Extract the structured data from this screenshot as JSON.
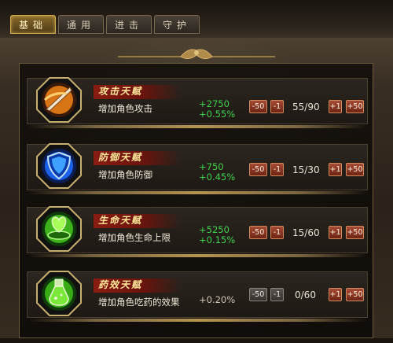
{
  "tabs": [
    {
      "label": "基础",
      "active": true
    },
    {
      "label": "通用",
      "active": false
    },
    {
      "label": "进击",
      "active": false
    },
    {
      "label": "守护",
      "active": false
    }
  ],
  "talents": [
    {
      "name": "攻击天赋",
      "desc": "增加角色攻击",
      "bonus1": "+2750",
      "bonus2": "+0.55%",
      "count": "55/90",
      "minus50": "-50",
      "minus1": "-1",
      "plus1": "+1",
      "plus50": "+50",
      "icon": "sword-slash-icon",
      "minus_enabled": true
    },
    {
      "name": "防御天赋",
      "desc": "增加角色防御",
      "bonus1": "+750",
      "bonus2": "+0.45%",
      "count": "15/30",
      "minus50": "-50",
      "minus1": "-1",
      "plus1": "+1",
      "plus50": "+50",
      "icon": "shield-icon",
      "minus_enabled": true
    },
    {
      "name": "生命天赋",
      "desc": "增加角色生命上限",
      "bonus1": "+5250",
      "bonus2": "+0.15%",
      "count": "15/60",
      "minus50": "-50",
      "minus1": "-1",
      "plus1": "+1",
      "plus50": "+50",
      "icon": "heart-icon",
      "minus_enabled": true
    },
    {
      "name": "药效天赋",
      "desc": "增加角色吃药的效果",
      "bonus1": "+0.20%",
      "bonus2": "",
      "count": "0/60",
      "minus50": "-50",
      "minus1": "-1",
      "plus1": "+1",
      "plus50": "+50",
      "icon": "potion-icon",
      "minus_enabled": false
    }
  ],
  "colors": {
    "bonus": "#3fd24a",
    "banner": "#8a1c12",
    "name": "#ffe79a"
  }
}
